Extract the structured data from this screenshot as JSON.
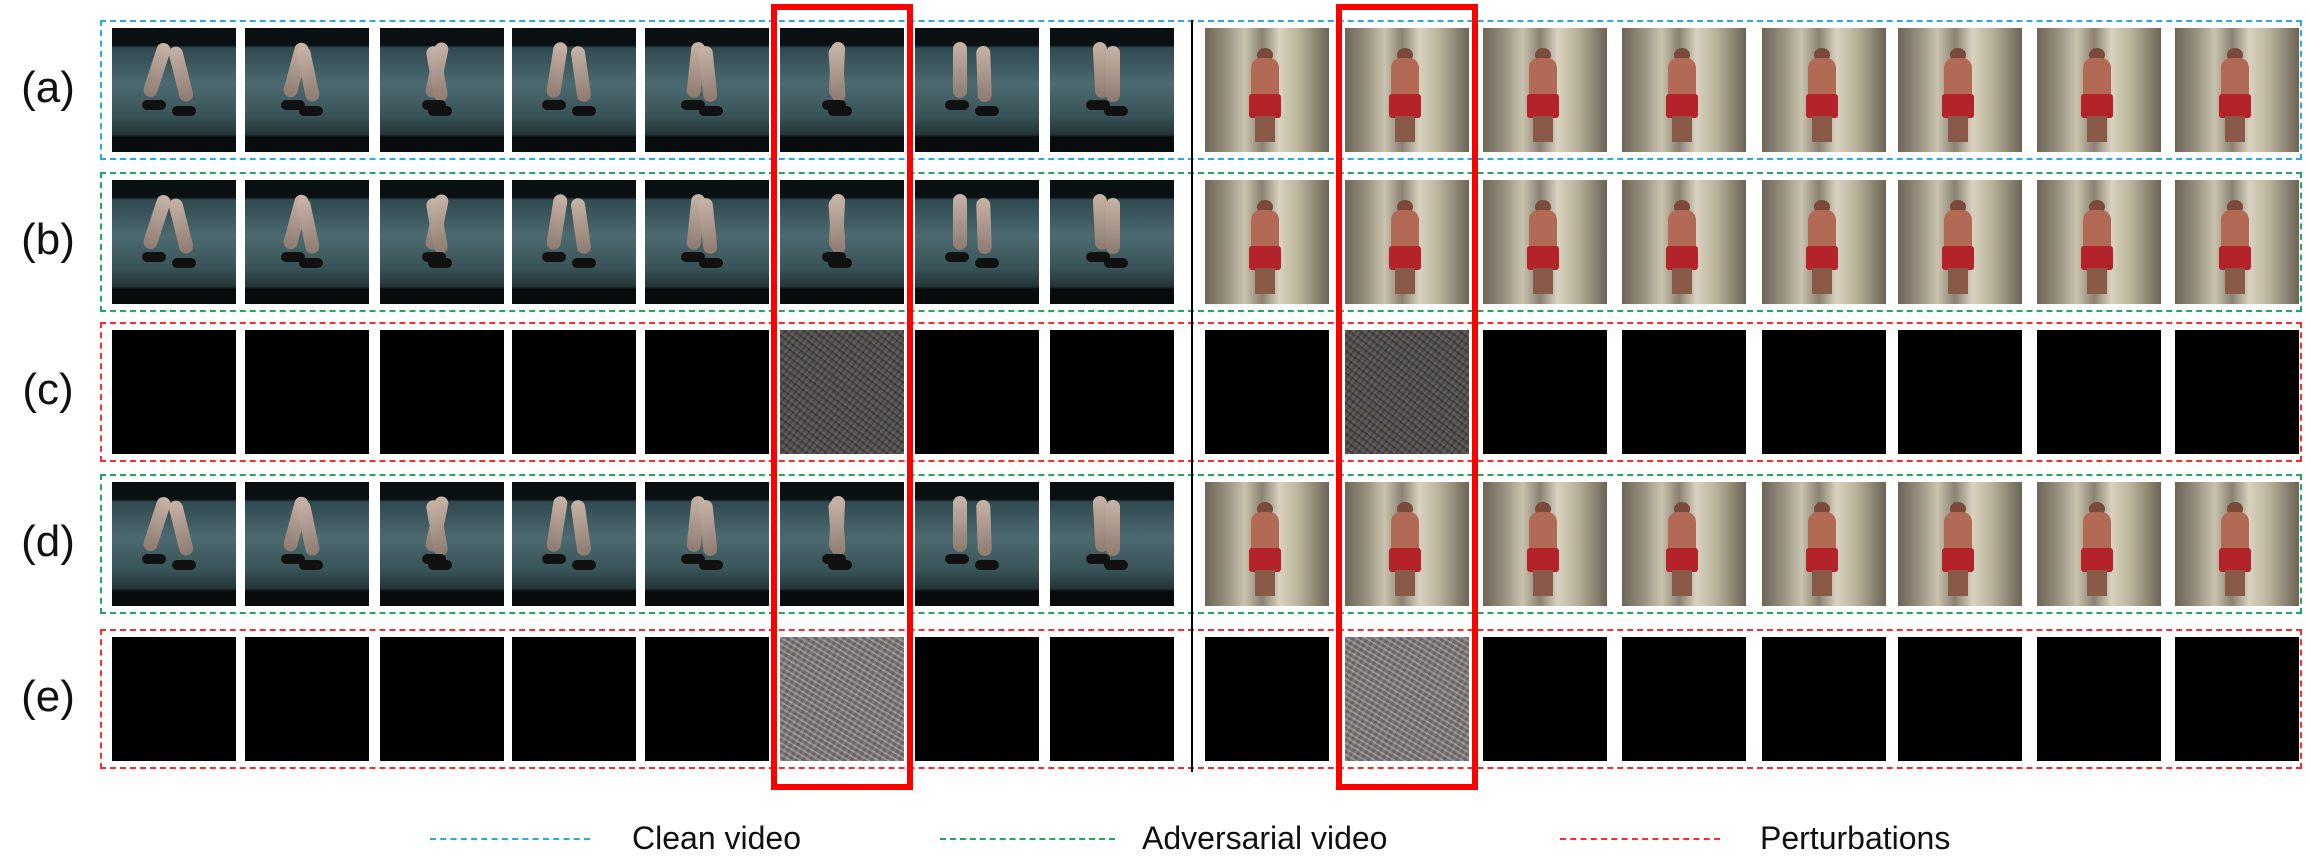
{
  "figure": {
    "rows": [
      {
        "label": "(a)",
        "kind": "clean"
      },
      {
        "label": "(b)",
        "kind": "adversarial"
      },
      {
        "label": "(c)",
        "kind": "perturbation"
      },
      {
        "label": "(d)",
        "kind": "adversarial"
      },
      {
        "label": "(e)",
        "kind": "perturbation"
      }
    ],
    "colors": {
      "clean": "#29abe2",
      "adversarial": "#1faa59",
      "perturbation": "#ff2a2a",
      "highlight": "#ff0000"
    },
    "left_video": {
      "frames_per_row": 8,
      "highlighted_frame": 6,
      "content": "running legs"
    },
    "right_video": {
      "frames_per_row": 8,
      "highlighted_frame": 2,
      "content": "person in gym"
    }
  },
  "legend": [
    {
      "label": "Clean video",
      "kind": "clean"
    },
    {
      "label": "Adversarial video",
      "kind": "adversarial"
    },
    {
      "label": "Perturbations",
      "kind": "perturbation"
    }
  ]
}
